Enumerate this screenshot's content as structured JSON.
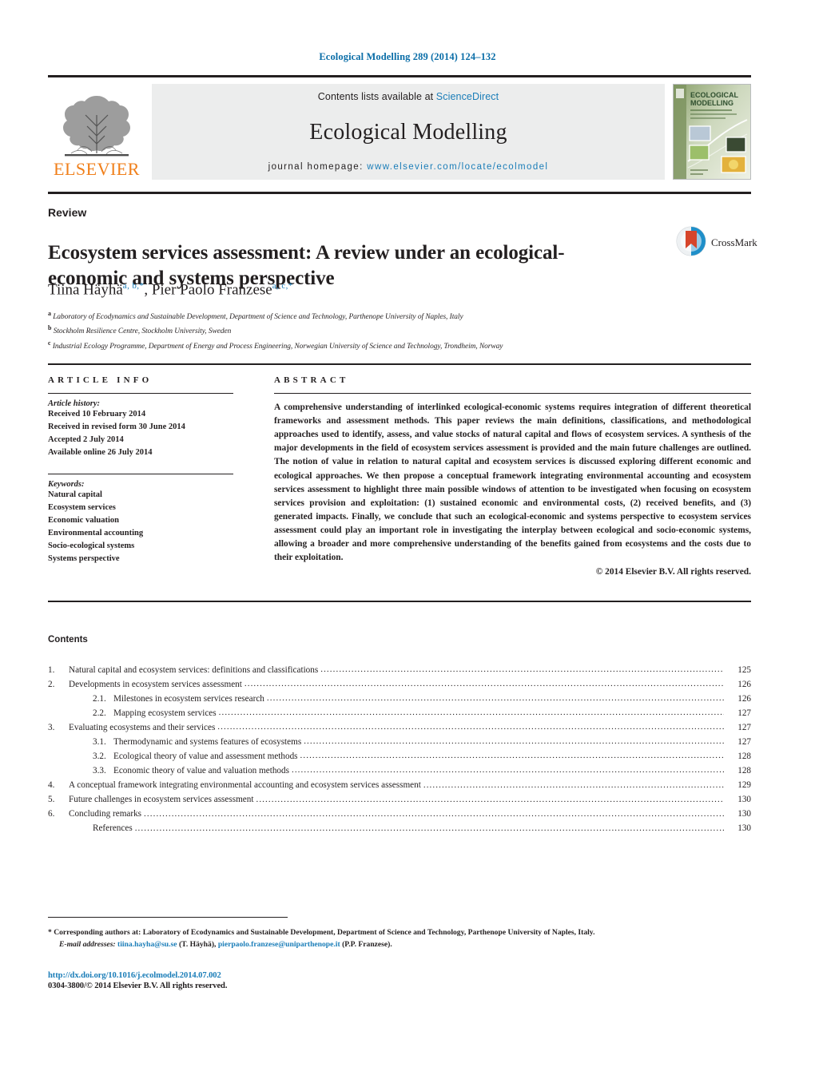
{
  "running_head": "Ecological Modelling 289 (2014) 124–132",
  "masthead": {
    "contents_prefix": "Contents lists available at ",
    "sciencedirect": "ScienceDirect",
    "journal_title": "Ecological Modelling",
    "homepage_prefix": "journal homepage: ",
    "homepage_url": "www.elsevier.com/locate/ecolmodel",
    "publisher": "ELSEVIER",
    "cover_title_line1": "ECOLOGICAL",
    "cover_title_line2": "MODELLING",
    "link_color": "#1a7db8",
    "publisher_color": "#f07f1a"
  },
  "article": {
    "doctype": "Review",
    "title": "Ecosystem services assessment: A review under an ecological-economic and systems perspective",
    "authors": [
      {
        "name": "Tiina Häyhä",
        "marks": "a, b,*"
      },
      {
        "name": "Pier Paolo Franzese",
        "marks": "a, c,*"
      }
    ],
    "affiliations": [
      {
        "mark": "a",
        "text": "Laboratory of Ecodynamics and Sustainable Development, Department of Science and Technology, Parthenope University of Naples, Italy"
      },
      {
        "mark": "b",
        "text": "Stockholm Resilience Centre, Stockholm University, Sweden"
      },
      {
        "mark": "c",
        "text": "Industrial Ecology Programme, Department of Energy and Process Engineering, Norwegian University of Science and Technology, Trondheim, Norway"
      }
    ],
    "crossmark_label": "CrossMark"
  },
  "article_info": {
    "heading": "ARTICLE INFO",
    "history_label": "Article history:",
    "history": [
      "Received 10 February 2014",
      "Received in revised form 30 June 2014",
      "Accepted 2 July 2014",
      "Available online 26 July 2014"
    ],
    "keywords_label": "Keywords:",
    "keywords": [
      "Natural capital",
      "Ecosystem services",
      "Economic valuation",
      "Environmental accounting",
      "Socio-ecological systems",
      "Systems perspective"
    ]
  },
  "abstract": {
    "heading": "ABSTRACT",
    "text": "A comprehensive understanding of interlinked ecological-economic systems requires integration of different theoretical frameworks and assessment methods. This paper reviews the main definitions, classifications, and methodological approaches used to identify, assess, and value stocks of natural capital and flows of ecosystem services. A synthesis of the major developments in the field of ecosystem services assessment is provided and the main future challenges are outlined. The notion of value in relation to natural capital and ecosystem services is discussed exploring different economic and ecological approaches. We then propose a conceptual framework integrating environmental accounting and ecosystem services assessment to highlight three main possible windows of attention to be investigated when focusing on ecosystem services provision and exploitation: (1) sustained economic and environmental costs, (2) received benefits, and (3) generated impacts. Finally, we conclude that such an ecological-economic and systems perspective to ecosystem services assessment could play an important role in investigating the interplay between ecological and socio-economic systems, allowing a broader and more comprehensive understanding of the benefits gained from ecosystems and the costs due to their exploitation.",
    "copyright": "© 2014 Elsevier B.V. All rights reserved."
  },
  "contents": {
    "heading": "Contents",
    "entries": [
      {
        "num": "1.",
        "sub": "",
        "label": "Natural capital and ecosystem services: definitions and classifications",
        "page": "125"
      },
      {
        "num": "2.",
        "sub": "",
        "label": "Developments in ecosystem services assessment",
        "page": "126"
      },
      {
        "num": "",
        "sub": "2.1.",
        "label": "Milestones in ecosystem services research",
        "page": "126"
      },
      {
        "num": "",
        "sub": "2.2.",
        "label": "Mapping ecosystem services",
        "page": "127"
      },
      {
        "num": "3.",
        "sub": "",
        "label": "Evaluating ecosystems and their services",
        "page": "127"
      },
      {
        "num": "",
        "sub": "3.1.",
        "label": "Thermodynamic and systems features of ecosystems",
        "page": "127"
      },
      {
        "num": "",
        "sub": "3.2.",
        "label": "Ecological theory of value and assessment methods",
        "page": "128"
      },
      {
        "num": "",
        "sub": "3.3.",
        "label": "Economic theory of value and valuation methods",
        "page": "128"
      },
      {
        "num": "4.",
        "sub": "",
        "label": "A conceptual framework integrating environmental accounting and ecosystem services assessment",
        "page": "129"
      },
      {
        "num": "5.",
        "sub": "",
        "label": "Future challenges in ecosystem services assessment",
        "page": "130"
      },
      {
        "num": "6.",
        "sub": "",
        "label": "Concluding remarks",
        "page": "130"
      },
      {
        "num": "",
        "sub": "",
        "label": "References",
        "page": "130",
        "noindent": true
      }
    ]
  },
  "footer": {
    "corresponding_mark": "*",
    "corresponding_text": "Corresponding authors at: Laboratory of Ecodynamics and Sustainable Development, Department of Science and Technology, Parthenope University of Naples, Italy.",
    "email_label": "E-mail addresses:",
    "email1": "tiina.hayha@su.se",
    "email1_owner": "(T. Häyhä),",
    "email2": "pierpaolo.franzese@uniparthenope.it",
    "email2_owner": "(P.P. Franzese).",
    "doi": "http://dx.doi.org/10.1016/j.ecolmodel.2014.07.002",
    "issn": "0304-3800/© 2014 Elsevier B.V. All rights reserved."
  }
}
